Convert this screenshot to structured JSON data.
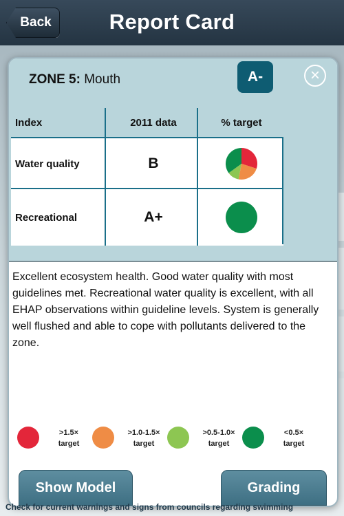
{
  "nav": {
    "back_label": "Back",
    "title": "Report Card"
  },
  "card": {
    "zone_label": "ZONE 5:",
    "zone_name": "Mouth",
    "grade": "A-",
    "close_icon": "close-icon"
  },
  "table": {
    "headers": [
      "Index",
      "2011 data",
      "% target"
    ],
    "rows": [
      {
        "index": "Water quality",
        "grade": "B",
        "pie": [
          {
            "value": 30,
            "color": "#e3263a"
          },
          {
            "value": 23,
            "color": "#ef8c45"
          },
          {
            "value": 12,
            "color": "#8dc652"
          },
          {
            "value": 35,
            "color": "#0b8e4c"
          }
        ]
      },
      {
        "index": "Recreational",
        "grade": "A+",
        "pie": [
          {
            "value": 100,
            "color": "#0b8e4c"
          }
        ]
      }
    ]
  },
  "description": "Excellent ecosystem health. Good water quality with most guidelines met. Recreational water quality is excellent, with all EHAP observations within guideline levels. System is generally well flushed and able to cope with pollutants delivered to the zone.",
  "legend": [
    {
      "line1": ">1.5×",
      "line2": "target",
      "color": "#e3263a"
    },
    {
      "line1": ">1.0-1.5×",
      "line2": "target",
      "color": "#ef8c45"
    },
    {
      "line1": ">0.5-1.0×",
      "line2": "target",
      "color": "#8dc652"
    },
    {
      "line1": "<0.5×",
      "line2": "target",
      "color": "#0b8e4c"
    }
  ],
  "buttons": {
    "show_model": "Show Model",
    "grading": "Grading"
  },
  "footer_note": "Check for current warnings and signs from councils regarding swimming"
}
